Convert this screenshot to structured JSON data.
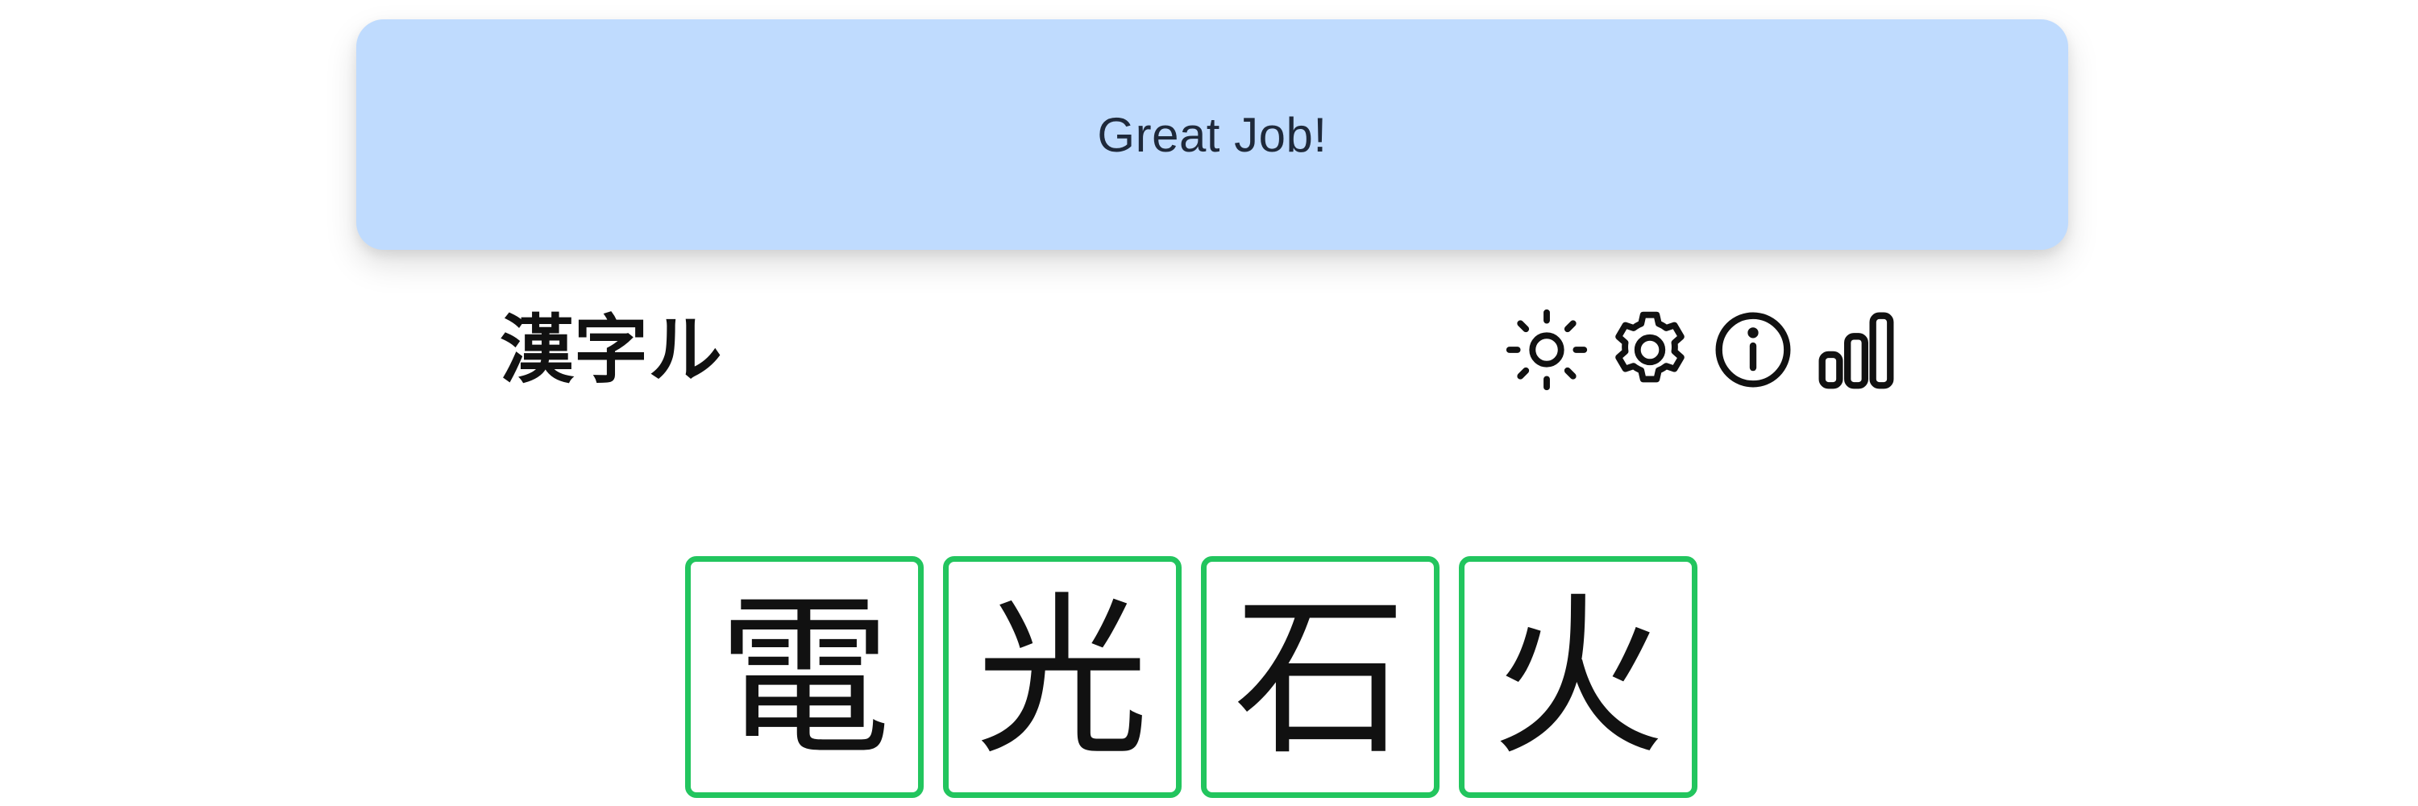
{
  "toast": {
    "message": "Great Job!"
  },
  "header": {
    "title": "漢字ル",
    "icons": [
      "sun-icon",
      "gear-icon",
      "info-icon",
      "chart-bars-icon"
    ]
  },
  "board": {
    "tiles": [
      {
        "char": "電",
        "state": "correct"
      },
      {
        "char": "光",
        "state": "correct"
      },
      {
        "char": "石",
        "state": "correct"
      },
      {
        "char": "火",
        "state": "correct"
      }
    ]
  },
  "colors": {
    "toast_bg": "#bfdbfe",
    "toast_text": "#1e293b",
    "correct": "#22c55e",
    "text": "#111111"
  }
}
